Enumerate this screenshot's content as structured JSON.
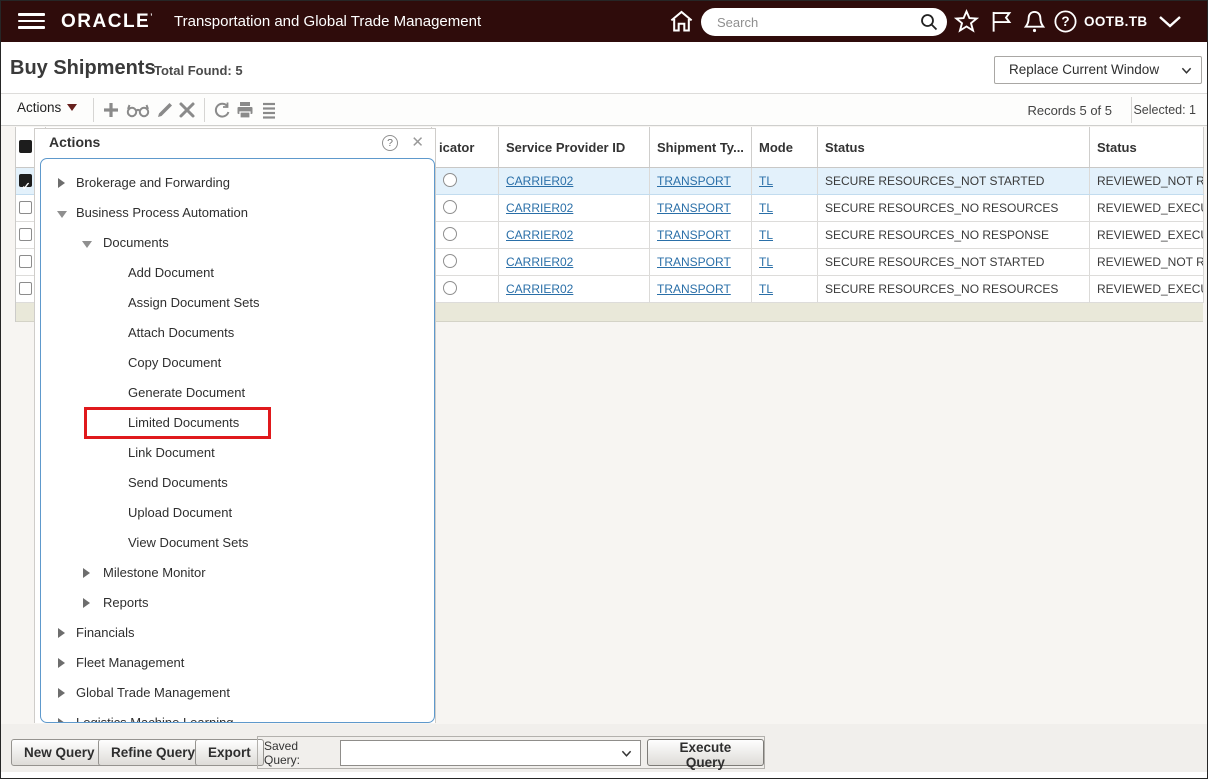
{
  "header": {
    "brand": "ORACLE",
    "app_title": "Transportation and Global Trade Management",
    "search_placeholder": "Search",
    "user": "OOTB.TB"
  },
  "page": {
    "title": "Buy Shipments",
    "total_found_label": "Total Found: 5",
    "window_mode": "Replace Current Window",
    "records_label": "Records 5 of 5",
    "selected_label": "Selected: 1"
  },
  "toolbar": {
    "actions_label": "Actions",
    "icons": [
      "add-icon",
      "view-icon",
      "edit-icon",
      "delete-icon",
      "refresh-icon",
      "print-icon",
      "list-icon"
    ]
  },
  "table": {
    "columns": [
      "icator",
      "Service Provider ID",
      "Shipment Ty...",
      "Mode",
      "Status",
      "Status"
    ],
    "rows": [
      {
        "selected": true,
        "service_provider": "CARRIER02",
        "shipment_type": "TRANSPORT",
        "mode": "TL",
        "status": "SECURE RESOURCES_NOT STARTED",
        "status2": "REVIEWED_NOT REV"
      },
      {
        "selected": false,
        "service_provider": "CARRIER02",
        "shipment_type": "TRANSPORT",
        "mode": "TL",
        "status": "SECURE RESOURCES_NO RESOURCES",
        "status2": "REVIEWED_EXECUTE"
      },
      {
        "selected": false,
        "service_provider": "CARRIER02",
        "shipment_type": "TRANSPORT",
        "mode": "TL",
        "status": "SECURE RESOURCES_NO RESPONSE",
        "status2": "REVIEWED_EXECUTE"
      },
      {
        "selected": false,
        "service_provider": "CARRIER02",
        "shipment_type": "TRANSPORT",
        "mode": "TL",
        "status": "SECURE RESOURCES_NOT STARTED",
        "status2": "REVIEWED_NOT REV"
      },
      {
        "selected": false,
        "service_provider": "CARRIER02",
        "shipment_type": "TRANSPORT",
        "mode": "TL",
        "status": "SECURE RESOURCES_NO RESOURCES",
        "status2": "REVIEWED_EXECUTE"
      }
    ]
  },
  "actions_popup": {
    "title": "Actions",
    "tree": [
      {
        "label": "Brokerage and Forwarding",
        "level": 0,
        "arrow": "collapsed"
      },
      {
        "label": "Business Process Automation",
        "level": 0,
        "arrow": "expanded"
      },
      {
        "label": "Documents",
        "level": 1,
        "arrow": "expanded"
      },
      {
        "label": "Add Document",
        "level": 2,
        "arrow": "none"
      },
      {
        "label": "Assign Document Sets",
        "level": 2,
        "arrow": "none"
      },
      {
        "label": "Attach Documents",
        "level": 2,
        "arrow": "none"
      },
      {
        "label": "Copy Document",
        "level": 2,
        "arrow": "none"
      },
      {
        "label": "Generate Document",
        "level": 2,
        "arrow": "none"
      },
      {
        "label": "Limited Documents",
        "level": 2,
        "arrow": "none",
        "highlighted": true
      },
      {
        "label": "Link Document",
        "level": 2,
        "arrow": "none"
      },
      {
        "label": "Send Documents",
        "level": 2,
        "arrow": "none"
      },
      {
        "label": "Upload Document",
        "level": 2,
        "arrow": "none"
      },
      {
        "label": "View Document Sets",
        "level": 2,
        "arrow": "none"
      },
      {
        "label": "Milestone Monitor",
        "level": 1,
        "arrow": "collapsed"
      },
      {
        "label": "Reports",
        "level": 1,
        "arrow": "collapsed"
      },
      {
        "label": "Financials",
        "level": 0,
        "arrow": "collapsed"
      },
      {
        "label": "Fleet Management",
        "level": 0,
        "arrow": "collapsed"
      },
      {
        "label": "Global Trade Management",
        "level": 0,
        "arrow": "collapsed"
      },
      {
        "label": "Logistics Machine Learning",
        "level": 0,
        "arrow": "collapsed"
      }
    ]
  },
  "query_bar": {
    "new_query": "New Query",
    "refine_query": "Refine Query",
    "export": "Export",
    "saved_query_label": "Saved Query:",
    "execute_query": "Execute Query"
  },
  "colors": {
    "banner": "#2f0c0b",
    "link": "#2a6fa8",
    "selected_row": "#e3f1fb",
    "summary_row": "#e9e8d9",
    "highlight_red": "#e0191c",
    "tree_border_blue": "#5e99cc"
  }
}
